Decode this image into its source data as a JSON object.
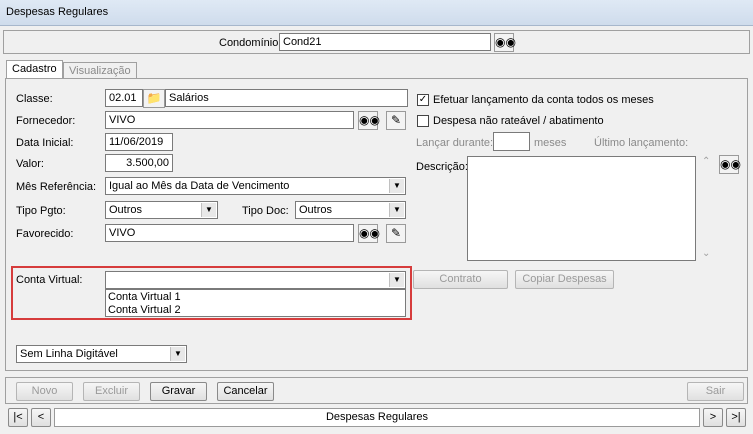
{
  "window": {
    "title": "Despesas Regulares"
  },
  "header": {
    "condominio_label": "Condomínio:",
    "condominio_value": "Cond21"
  },
  "tabs": [
    {
      "label": "Cadastro"
    },
    {
      "label": "Visualização"
    }
  ],
  "form": {
    "classe_label": "Classe:",
    "classe_code": "02.01",
    "classe_name": "Salários",
    "fornecedor_label": "Fornecedor:",
    "fornecedor_value": "VIVO",
    "data_inicial_label": "Data Inicial:",
    "data_inicial_value": "11/06/2019",
    "valor_label": "Valor:",
    "valor_value": "3.500,00",
    "mes_ref_label": "Mês Referência:",
    "mes_ref_value": "Igual ao Mês da Data de Vencimento",
    "tipo_pgto_label": "Tipo Pgto:",
    "tipo_pgto_value": "Outros",
    "tipo_doc_label": "Tipo Doc:",
    "tipo_doc_value": "Outros",
    "favorecido_label": "Favorecido:",
    "favorecido_value": "VIVO",
    "conta_virtual_label": "Conta Virtual:",
    "conta_virtual_value": "",
    "conta_virtual_options": [
      "Conta Virtual 1",
      "Conta Virtual 2"
    ],
    "linha_digitavel_value": "Sem Linha Digitável"
  },
  "right": {
    "efetuar_label": "Efetuar lançamento da conta todos os meses",
    "efetuar_checked": true,
    "nao_rateavel_label": "Despesa não rateável / abatimento",
    "nao_rateavel_checked": false,
    "lancar_durante_label": "Lançar durante:",
    "meses_label": "meses",
    "ultimo_lancamento_label": "Último lançamento:",
    "descricao_label": "Descrição:",
    "contrato_label": "Contrato",
    "copiar_label": "Copiar Despesas"
  },
  "footer": {
    "novo": "Novo",
    "excluir": "Excluir",
    "gravar": "Gravar",
    "cancelar": "Cancelar",
    "sair": "Sair",
    "nav_first": "|<",
    "nav_prev": "<",
    "nav_label": "Despesas Regulares",
    "nav_next": ">",
    "nav_last": ">|"
  }
}
